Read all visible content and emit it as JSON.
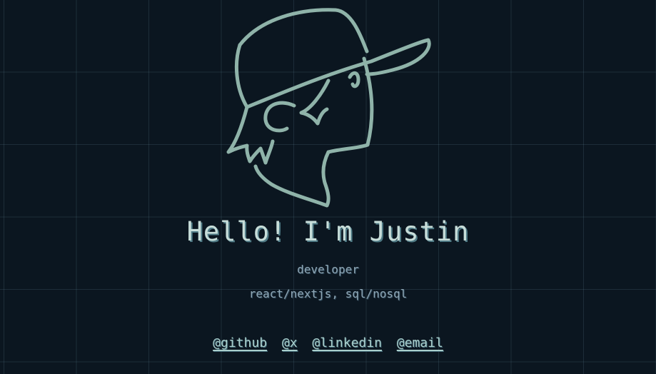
{
  "hero": {
    "title": "Hello! I'm Justin",
    "role": "developer",
    "stack": "react/nextjs, sql/nosql",
    "accent_color": "#8fb3a9",
    "avatar_icon": "cap-profile-avatar-icon"
  },
  "links": [
    {
      "label": "@github"
    },
    {
      "label": "@x"
    },
    {
      "label": "@linkedin"
    },
    {
      "label": "@email"
    }
  ],
  "background": {
    "color": "#0b1620",
    "grid": true
  }
}
